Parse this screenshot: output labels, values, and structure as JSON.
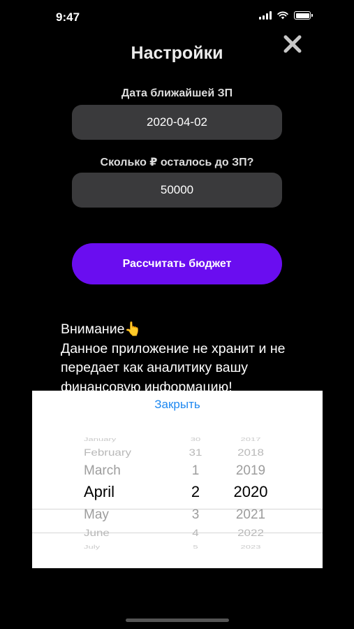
{
  "status_bar": {
    "time": "9:47"
  },
  "header": {
    "title": "Настройки",
    "close_icon": "close-icon"
  },
  "form": {
    "date_label": "Дата ближайшей ЗП",
    "date_value": "2020-04-02",
    "amount_label": "Сколько ₽ осталось до ЗП?",
    "amount_value": "50000",
    "calc_button": "Рассчитать бюджет"
  },
  "notice": {
    "heading": "Внимание👆",
    "text": "Данное приложение не хранит и не передает как аналитику вашу финансовую информацию!"
  },
  "picker": {
    "close_label": "Закрыть",
    "months": [
      "January",
      "February",
      "March",
      "April",
      "May",
      "June",
      "July"
    ],
    "days": [
      "30",
      "31",
      "1",
      "2",
      "3",
      "4",
      "5"
    ],
    "years": [
      "2017",
      "2018",
      "2019",
      "2020",
      "2021",
      "2022",
      "2023"
    ],
    "selected": {
      "month": "April",
      "day": "2",
      "year": "2020"
    }
  },
  "colors": {
    "background": "#000000",
    "field": "#3a3a3c",
    "accent": "#6a0df0",
    "link": "#1e88f0"
  }
}
